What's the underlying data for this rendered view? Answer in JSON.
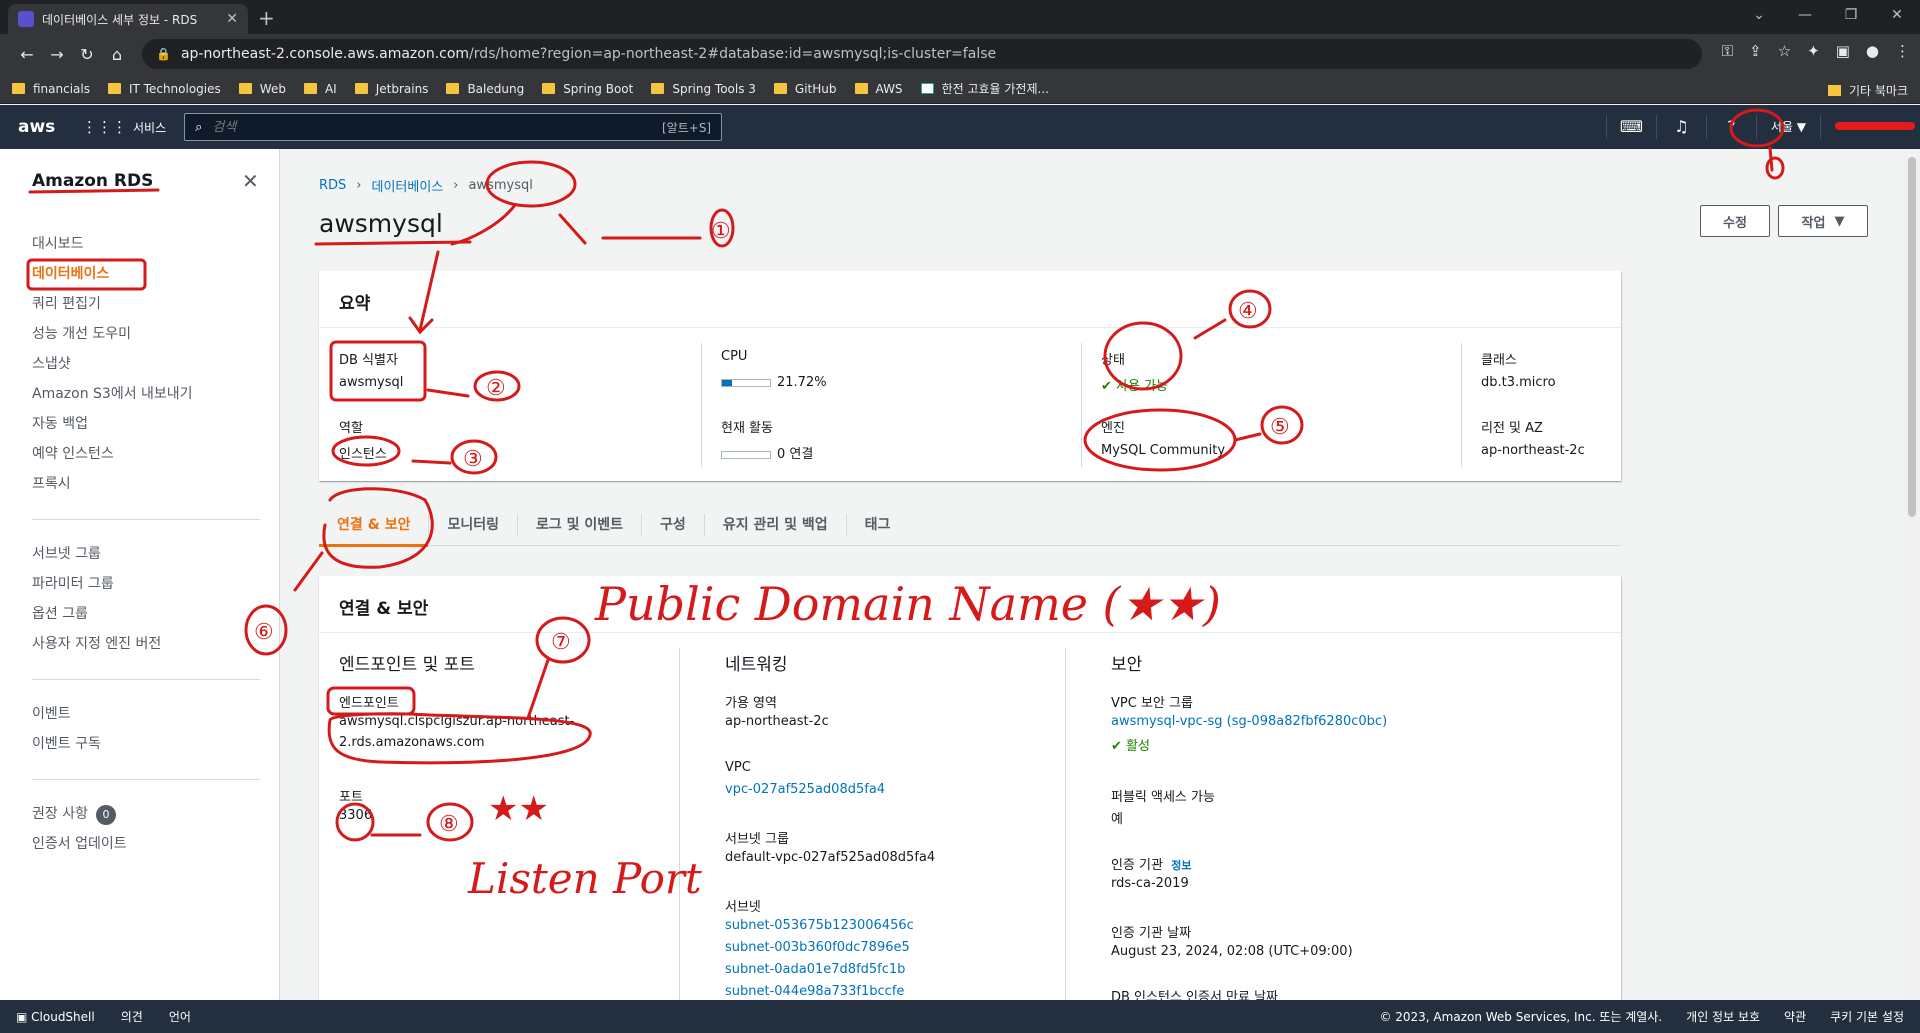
{
  "browser": {
    "tab_title": "데이터베이스 세부 정보 - RDS",
    "url_host": "ap-northeast-2.console.aws.amazon.com",
    "url_path": "/rds/home?region=ap-northeast-2#database:id=awsmysql;is-cluster=false",
    "bookmarks": [
      "financials",
      "IT Technologies",
      "Web",
      "AI",
      "Jetbrains",
      "Baledung",
      "Spring Boot",
      "Spring Tools 3",
      "GitHub",
      "AWS",
      "한전 고효율 가전제..."
    ],
    "other_bookmarks": "기타 북마크"
  },
  "awsnav": {
    "logo": "aws",
    "services": "서비스",
    "search_placeholder": "검색",
    "search_hint": "[알트+S]",
    "region": "서울"
  },
  "sidebar": {
    "title": "Amazon RDS",
    "group1": [
      "대시보드",
      "데이터베이스",
      "쿼리 편집기",
      "성능 개선 도우미",
      "스냅샷",
      "Amazon S3에서 내보내기",
      "자동 백업",
      "예약 인스턴스",
      "프록시"
    ],
    "group2": [
      "서브넷 그룹",
      "파라미터 그룹",
      "옵션 그룹",
      "사용자 지정 엔진 버전"
    ],
    "group3": [
      "이벤트",
      "이벤트 구독"
    ],
    "recommendations": "권장 사항",
    "recommendations_count": "0",
    "cert_update": "인증서 업데이트"
  },
  "breadcrumb": {
    "root": "RDS",
    "mid": "데이터베이스",
    "current": "awsmysql"
  },
  "page_title": "awsmysql",
  "actions": {
    "modify": "수정",
    "actions": "작업"
  },
  "summary": {
    "heading": "요약",
    "db_id_label": "DB 식별자",
    "db_id": "awsmysql",
    "cpu_label": "CPU",
    "cpu": "21.72%",
    "cpu_fraction": 0.2172,
    "status_label": "상태",
    "status": "사용 가능",
    "class_label": "클래스",
    "class": "db.t3.micro",
    "role_label": "역할",
    "role": "인스턴스",
    "activity_label": "현재 활동",
    "activity": "0 연결",
    "engine_label": "엔진",
    "engine": "MySQL Community",
    "region_label": "리전 및 AZ",
    "region": "ap-northeast-2c"
  },
  "tabs": [
    "연결 & 보안",
    "모니터링",
    "로그 및 이벤트",
    "구성",
    "유지 관리 및 백업",
    "태그"
  ],
  "connectivity": {
    "heading": "연결 & 보안",
    "endpoint_col": "엔드포인트 및 포트",
    "endpoint_label": "엔드포인트",
    "endpoint_line1": "awsmysql.clspclgiszur.ap-northeast-",
    "endpoint_line2": "2.rds.amazonaws.com",
    "port_label": "포트",
    "port": "3306",
    "network_col": "네트워킹",
    "az_label": "가용 영역",
    "az": "ap-northeast-2c",
    "vpc_label": "VPC",
    "vpc": "vpc-027af525ad08d5fa4",
    "subnet_group_label": "서브넷 그룹",
    "subnet_group": "default-vpc-027af525ad08d5fa4",
    "subnets_label": "서브넷",
    "subnets": [
      "subnet-053675b123006456c",
      "subnet-003b360f0dc7896e5",
      "subnet-0ada01e7d8fd5fc1b",
      "subnet-044e98a733f1bccfe"
    ],
    "security_col": "보안",
    "sg_label": "VPC 보안 그룹",
    "sg": "awsmysql-vpc-sg (sg-098a82fbf6280c0bc)",
    "sg_status": "활성",
    "public_label": "퍼블릭 액세스 가능",
    "public": "예",
    "ca_label": "인증 기관",
    "ca_info": "정보",
    "ca": "rds-ca-2019",
    "ca_date_label": "인증 기관 날짜",
    "ca_date": "August 23, 2024, 02:08 (UTC+09:00)",
    "cert_expiry_label": "DB 인스턴스 인증서 만료 날짜"
  },
  "footer": {
    "cloudshell": "CloudShell",
    "feedback": "의견",
    "language": "언어",
    "copyright": "© 2023, Amazon Web Services, Inc. 또는 계열사.",
    "privacy": "개인 정보 보호",
    "terms": "약관",
    "cookies": "쿠키 기본 설정"
  },
  "annotations": {
    "n1": "①",
    "n2": "②",
    "n3": "③",
    "n4": "④",
    "n5": "⑤",
    "n6": "⑥",
    "n7": "⑦",
    "n8": "⑧",
    "public_domain": "Public Domain Name (★★)",
    "listen_port": "Listen Port",
    "stars": "★★"
  }
}
